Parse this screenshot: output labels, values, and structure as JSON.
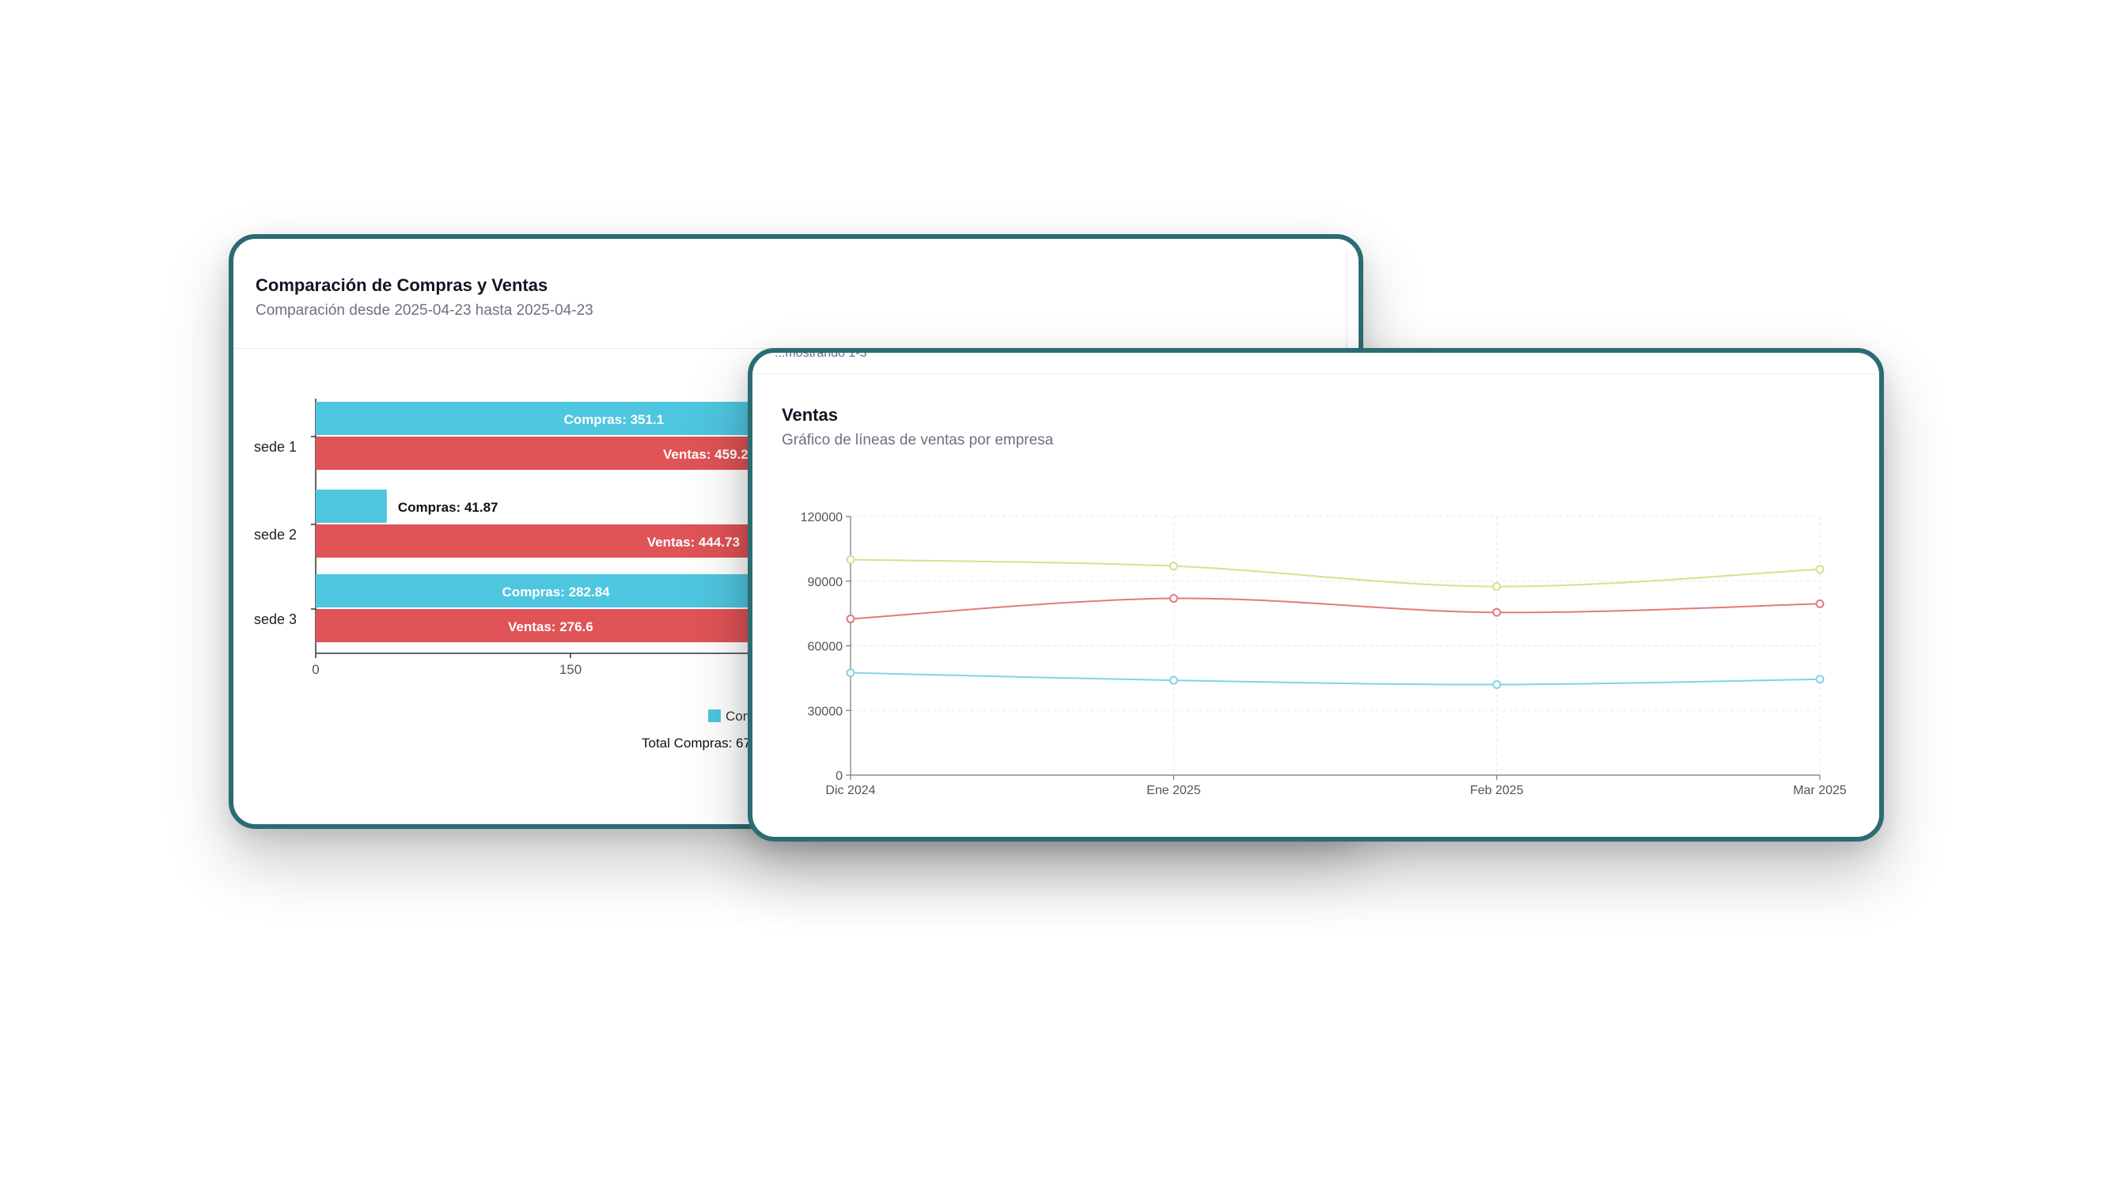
{
  "bar_card": {
    "title": "Comparación de Compras y Ventas",
    "subtitle": "Comparación desde 2025-04-23 hasta 2025-04-23",
    "legend_partial": "Com",
    "total_partial": "Total Compras: 67"
  },
  "line_card": {
    "title": "Ventas",
    "subtitle": "Gráfico de líneas de ventas por empresa",
    "peek_text": "...mostrando 1-3"
  },
  "colors": {
    "border": "#2b6c73",
    "compras": "#4fc6e0",
    "ventas": "#e05356",
    "line_yellow": "#d7e08e",
    "line_red": "#e07b7b",
    "line_cyan": "#82d3e4"
  },
  "chart_data": [
    {
      "type": "bar",
      "orientation": "horizontal",
      "title": "Comparación de Compras y Ventas",
      "subtitle": "Comparación desde 2025-04-23 hasta 2025-04-23",
      "categories": [
        "sede 1",
        "sede 2",
        "sede 3"
      ],
      "series": [
        {
          "name": "Compras",
          "color": "#4fc6e0",
          "values": [
            351.1,
            41.87,
            282.84
          ],
          "labels": [
            "Compras: 351.1",
            "Compras: 41.87",
            "Compras: 282.84"
          ]
        },
        {
          "name": "Ventas",
          "color": "#e05356",
          "values": [
            459.2,
            444.73,
            276.6
          ],
          "labels": [
            "Ventas: 459.2",
            "Ventas: 444.73",
            "Ventas: 276.6"
          ]
        }
      ],
      "x_ticks": [
        "0",
        "150"
      ],
      "xlim": [
        0,
        600
      ],
      "grid": false
    },
    {
      "type": "line",
      "title": "Ventas",
      "subtitle": "Gráfico de líneas de ventas por empresa",
      "x": [
        "Dic 2024",
        "Ene 2025",
        "Feb 2025",
        "Mar 2025"
      ],
      "y_ticks": [
        "0",
        "30000",
        "60000",
        "90000",
        "120000"
      ],
      "ylim": [
        0,
        120000
      ],
      "grid": true,
      "series": [
        {
          "color": "#d7e08e",
          "values": [
            100000,
            97000,
            87500,
            95500
          ]
        },
        {
          "color": "#e07b7b",
          "values": [
            72500,
            82000,
            75500,
            79500
          ]
        },
        {
          "color": "#82d3e4",
          "values": [
            47500,
            44000,
            42000,
            44500
          ]
        }
      ]
    }
  ]
}
